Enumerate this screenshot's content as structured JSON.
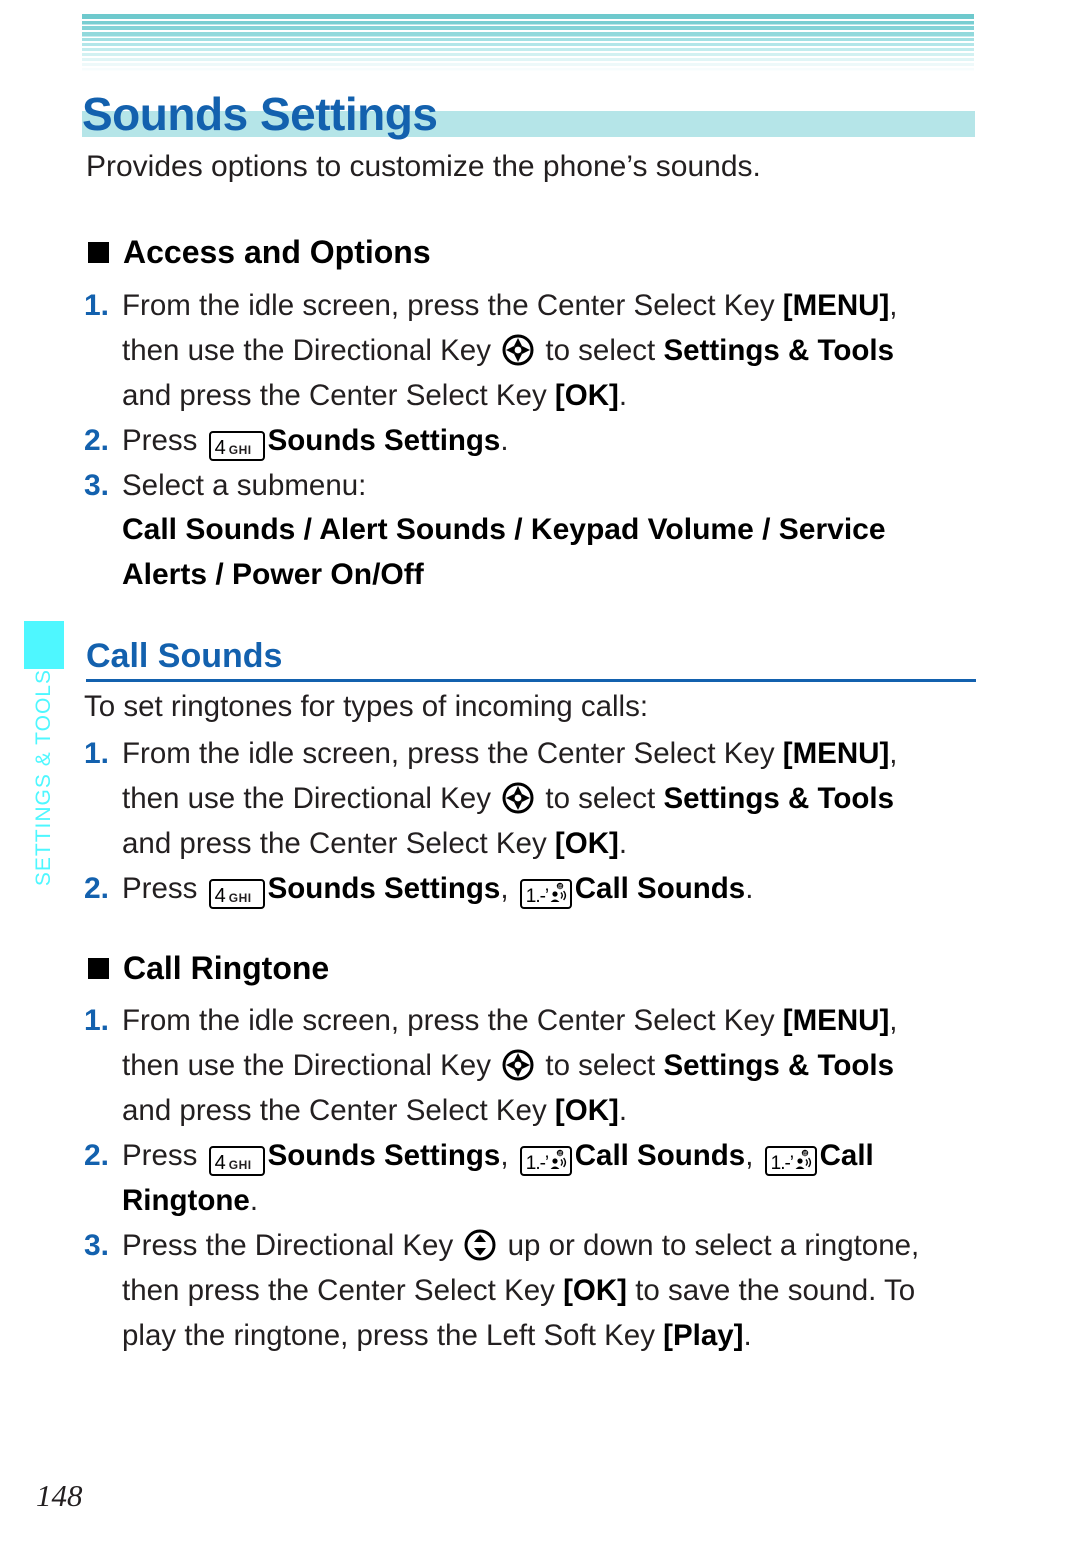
{
  "page": {
    "title": "Sounds Settings",
    "intro": "Provides options to customize the phone’s sounds.",
    "number": "148",
    "side_tab_label": "SETTINGS & TOOLS",
    "accent_blue": "#1361ae",
    "accent_cyan": "#4ef7ff",
    "title_band_teal": "#b5e5e8"
  },
  "keys": {
    "key4_digit": "4",
    "key4_letters": "GHI",
    "key1_digit": "1.-’",
    "dpad_four_way_name": "Directional Key (4-way)",
    "dpad_up_down_name": "Directional Key (up/down)"
  },
  "sections": {
    "access_and_options": {
      "heading": "Access and Options",
      "steps": [
        {
          "num": "1.",
          "line1_a": "From the idle screen, press the Center Select Key ",
          "line1_b": "[MENU]",
          "line1_c": ",",
          "line2_a": "then use the Directional Key ",
          "line2_b": " to select ",
          "line2_c": "Settings & Tools",
          "line3_a": "and press the Center Select Key ",
          "line3_b": "[OK]",
          "line3_c": "."
        },
        {
          "num": "2.",
          "press": "Press ",
          "target": "Sounds Settings",
          "period": "."
        },
        {
          "num": "3.",
          "text": "Select a submenu:"
        }
      ],
      "submenu_line1": "Call Sounds / Alert Sounds / Keypad Volume / Service",
      "submenu_line2": "Alerts / Power On/Off"
    },
    "call_sounds": {
      "heading": "Call Sounds",
      "lead": "To set ringtones for types of incoming calls:",
      "steps": [
        {
          "num": "1.",
          "line1_a": "From the idle screen, press the Center Select Key ",
          "line1_b": "[MENU]",
          "line1_c": ",",
          "line2_a": "then use the Directional Key ",
          "line2_b": " to select ",
          "line2_c": "Settings & Tools",
          "line3_a": "and press the Center Select Key ",
          "line3_b": "[OK]",
          "line3_c": "."
        },
        {
          "num": "2.",
          "press": "Press ",
          "target1": "Sounds Settings",
          "comma": ", ",
          "target2": "Call Sounds",
          "period": "."
        }
      ]
    },
    "call_ringtone": {
      "heading": "Call Ringtone",
      "steps": [
        {
          "num": "1.",
          "line1_a": "From the idle screen, press the Center Select Key ",
          "line1_b": "[MENU]",
          "line1_c": ",",
          "line2_a": "then use the Directional Key ",
          "line2_b": " to select ",
          "line2_c": "Settings & Tools",
          "line3_a": "and press the Center Select Key ",
          "line3_b": "[OK]",
          "line3_c": "."
        },
        {
          "num": "2.",
          "press": "Press ",
          "target1": "Sounds Settings",
          "comma1": ", ",
          "target2": "Call Sounds",
          "comma2": ", ",
          "target3": "Call",
          "target3_cont": "Ringtone",
          "period": "."
        },
        {
          "num": "3.",
          "line1_a": "Press the Directional Key ",
          "line1_b": " up or down to select a ringtone,",
          "line2_a": "then press the Center Select Key ",
          "line2_b": "[OK]",
          "line2_c": " to save the sound. To",
          "line3_a": "play the ringtone, press the Left Soft Key ",
          "line3_b": "[Play]",
          "line3_c": "."
        }
      ]
    }
  }
}
